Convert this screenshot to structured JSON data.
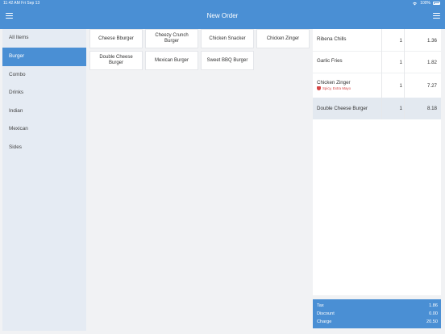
{
  "status_bar": {
    "time_date": "11:42 AM   Fri Sep 13",
    "wifi_icon": "wifi-icon",
    "battery": "100%"
  },
  "header": {
    "title": "New Order",
    "left_icon": "hamburger-menu-icon",
    "right_icon": "hamburger-menu-icon",
    "color": "#4a8fd4"
  },
  "categories": [
    {
      "label": "All Items",
      "active": false
    },
    {
      "label": "Burger",
      "active": true
    },
    {
      "label": "Combo",
      "active": false
    },
    {
      "label": "Drinks",
      "active": false
    },
    {
      "label": "Indian",
      "active": false
    },
    {
      "label": "Mexican",
      "active": false
    },
    {
      "label": "Sides",
      "active": false
    }
  ],
  "products": [
    {
      "label": "Cheese Bburger"
    },
    {
      "label": "Cheezy Crunch Burger"
    },
    {
      "label": "Chicken Snacker"
    },
    {
      "label": "Chicken Zinger"
    },
    {
      "label": "Double Cheese Burger"
    },
    {
      "label": "Mexican Burger"
    },
    {
      "label": "Sweet BBQ Burger"
    }
  ],
  "order": {
    "items": [
      {
        "name": "Ribena Chills",
        "qty": "1",
        "price": "1.36",
        "modifiers": "",
        "selected": false
      },
      {
        "name": "Garlic Fries",
        "qty": "1",
        "price": "1.82",
        "modifiers": "",
        "selected": false
      },
      {
        "name": "Chicken Zinger",
        "qty": "1",
        "price": "7.27",
        "modifiers": "Spicy, Extra Mayo",
        "selected": false
      },
      {
        "name": "Double Cheese Burger",
        "qty": "1",
        "price": "8.18",
        "modifiers": "",
        "selected": true
      }
    ]
  },
  "totals": {
    "tax_label": "Tax",
    "tax": "1.86",
    "discount_label": "Discount",
    "discount": "0.00",
    "charge_label": "Charge",
    "charge": "20.50"
  }
}
